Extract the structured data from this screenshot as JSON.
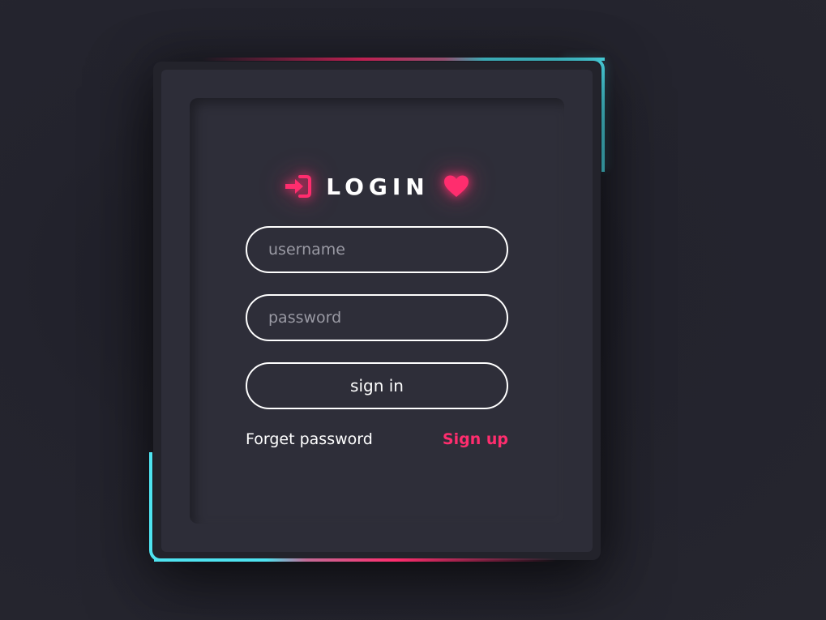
{
  "login": {
    "title": "LOGIN",
    "title_left_icon": "sign-in-icon",
    "title_right_icon": "heart-icon",
    "username_placeholder": "username",
    "password_placeholder": "password",
    "signin_label": "sign in",
    "forget_label": "Forget password",
    "signup_label": "Sign up"
  },
  "colors": {
    "accent_pink": "#ff2d6e",
    "accent_cyan": "#4fe3f0",
    "background": "#25252f",
    "card": "#2d2d38"
  }
}
